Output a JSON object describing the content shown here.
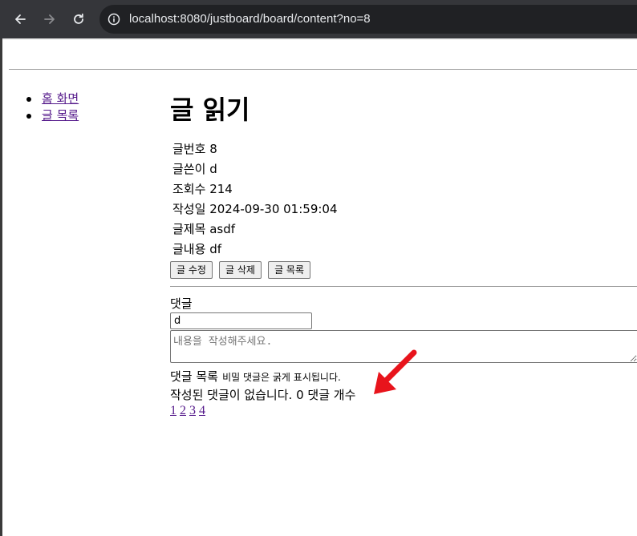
{
  "browser": {
    "url": "localhost:8080/justboard/board/content?no=8",
    "back_icon": "arrow-left-icon",
    "forward_icon": "arrow-right-icon",
    "reload_icon": "reload-icon",
    "info_icon": "info-icon"
  },
  "nav": {
    "items": [
      {
        "label": "홈 화면"
      },
      {
        "label": "글 목록"
      }
    ]
  },
  "page": {
    "title": "글 읽기"
  },
  "post": {
    "fields": [
      {
        "label": "글번호",
        "value": "8"
      },
      {
        "label": "글쓴이",
        "value": "d"
      },
      {
        "label": "조회수",
        "value": "214"
      },
      {
        "label": "작성일",
        "value": "2024-09-30 01:59:04"
      },
      {
        "label": "글제목",
        "value": "asdf"
      },
      {
        "label": "글내용",
        "value": "df"
      }
    ],
    "buttons": {
      "edit": "글 수정",
      "delete": "글 삭제",
      "list": "글 목록"
    }
  },
  "comments": {
    "label": "댓글",
    "writer_value": "d",
    "content_placeholder": "내용을 작성해주세요.",
    "list_title": "댓글 목록",
    "secret_note": "비밀 댓글은 굵게 표시됩니다.",
    "empty_message": "작성된 댓글이 없습니다.",
    "count_value": "0",
    "count_label": "댓글 개수",
    "pages": [
      "1",
      "2",
      "3",
      "4"
    ]
  },
  "colors": {
    "toolbar": "#35363a",
    "omnibox": "#202124",
    "link": "#551a8b",
    "annotation_arrow": "#e8141c"
  }
}
